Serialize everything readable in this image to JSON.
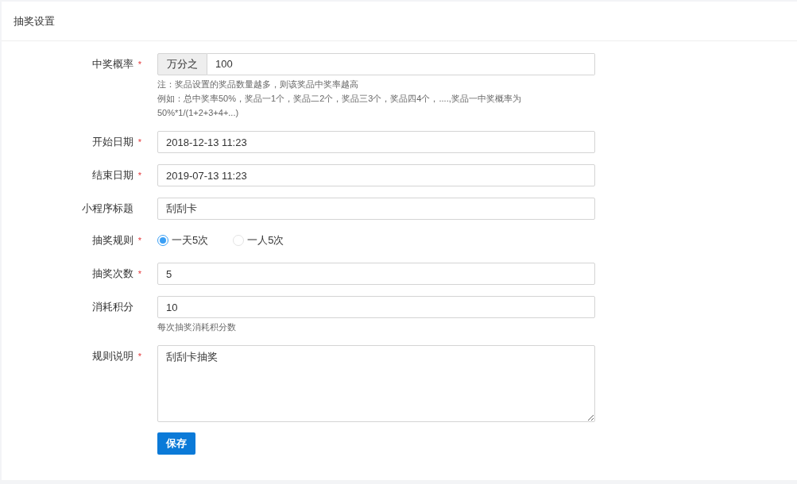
{
  "panel": {
    "title": "抽奖设置"
  },
  "fields": [
    {
      "kind": "addon-input",
      "label": "中奖概率",
      "required_mark": "*",
      "addon": "万分之",
      "value": "100",
      "help": [
        "注：奖品设置的奖品数量越多，则该奖品中奖率越高",
        "例如：总中奖率50%，奖品一1个，奖品二2个，奖品三3个，奖品四4个，....,奖品一中奖概率为",
        "50%*1/(1+2+3+4+...)"
      ]
    },
    {
      "kind": "input",
      "label": "开始日期",
      "required_mark": "*",
      "value": "2018-12-13 11:23"
    },
    {
      "kind": "input",
      "label": "结束日期",
      "required_mark": "*",
      "value": "2019-07-13 11:23"
    },
    {
      "kind": "input",
      "label": "小程序标题",
      "value": "刮刮卡"
    },
    {
      "kind": "radio",
      "label": "抽奖规则",
      "required_mark": "*",
      "options": [
        {
          "label": "一天5次",
          "selected": true
        },
        {
          "label": "一人5次",
          "selected": false
        }
      ]
    },
    {
      "kind": "input",
      "label": "抽奖次数",
      "required_mark": "*",
      "value": "5"
    },
    {
      "kind": "input",
      "label": "消耗积分",
      "value": "10",
      "help": [
        "每次抽奖消耗积分数"
      ]
    },
    {
      "kind": "textarea",
      "label": "规则说明",
      "required_mark": "*",
      "value": "刮刮卡抽奖"
    }
  ],
  "save_button": "保存"
}
